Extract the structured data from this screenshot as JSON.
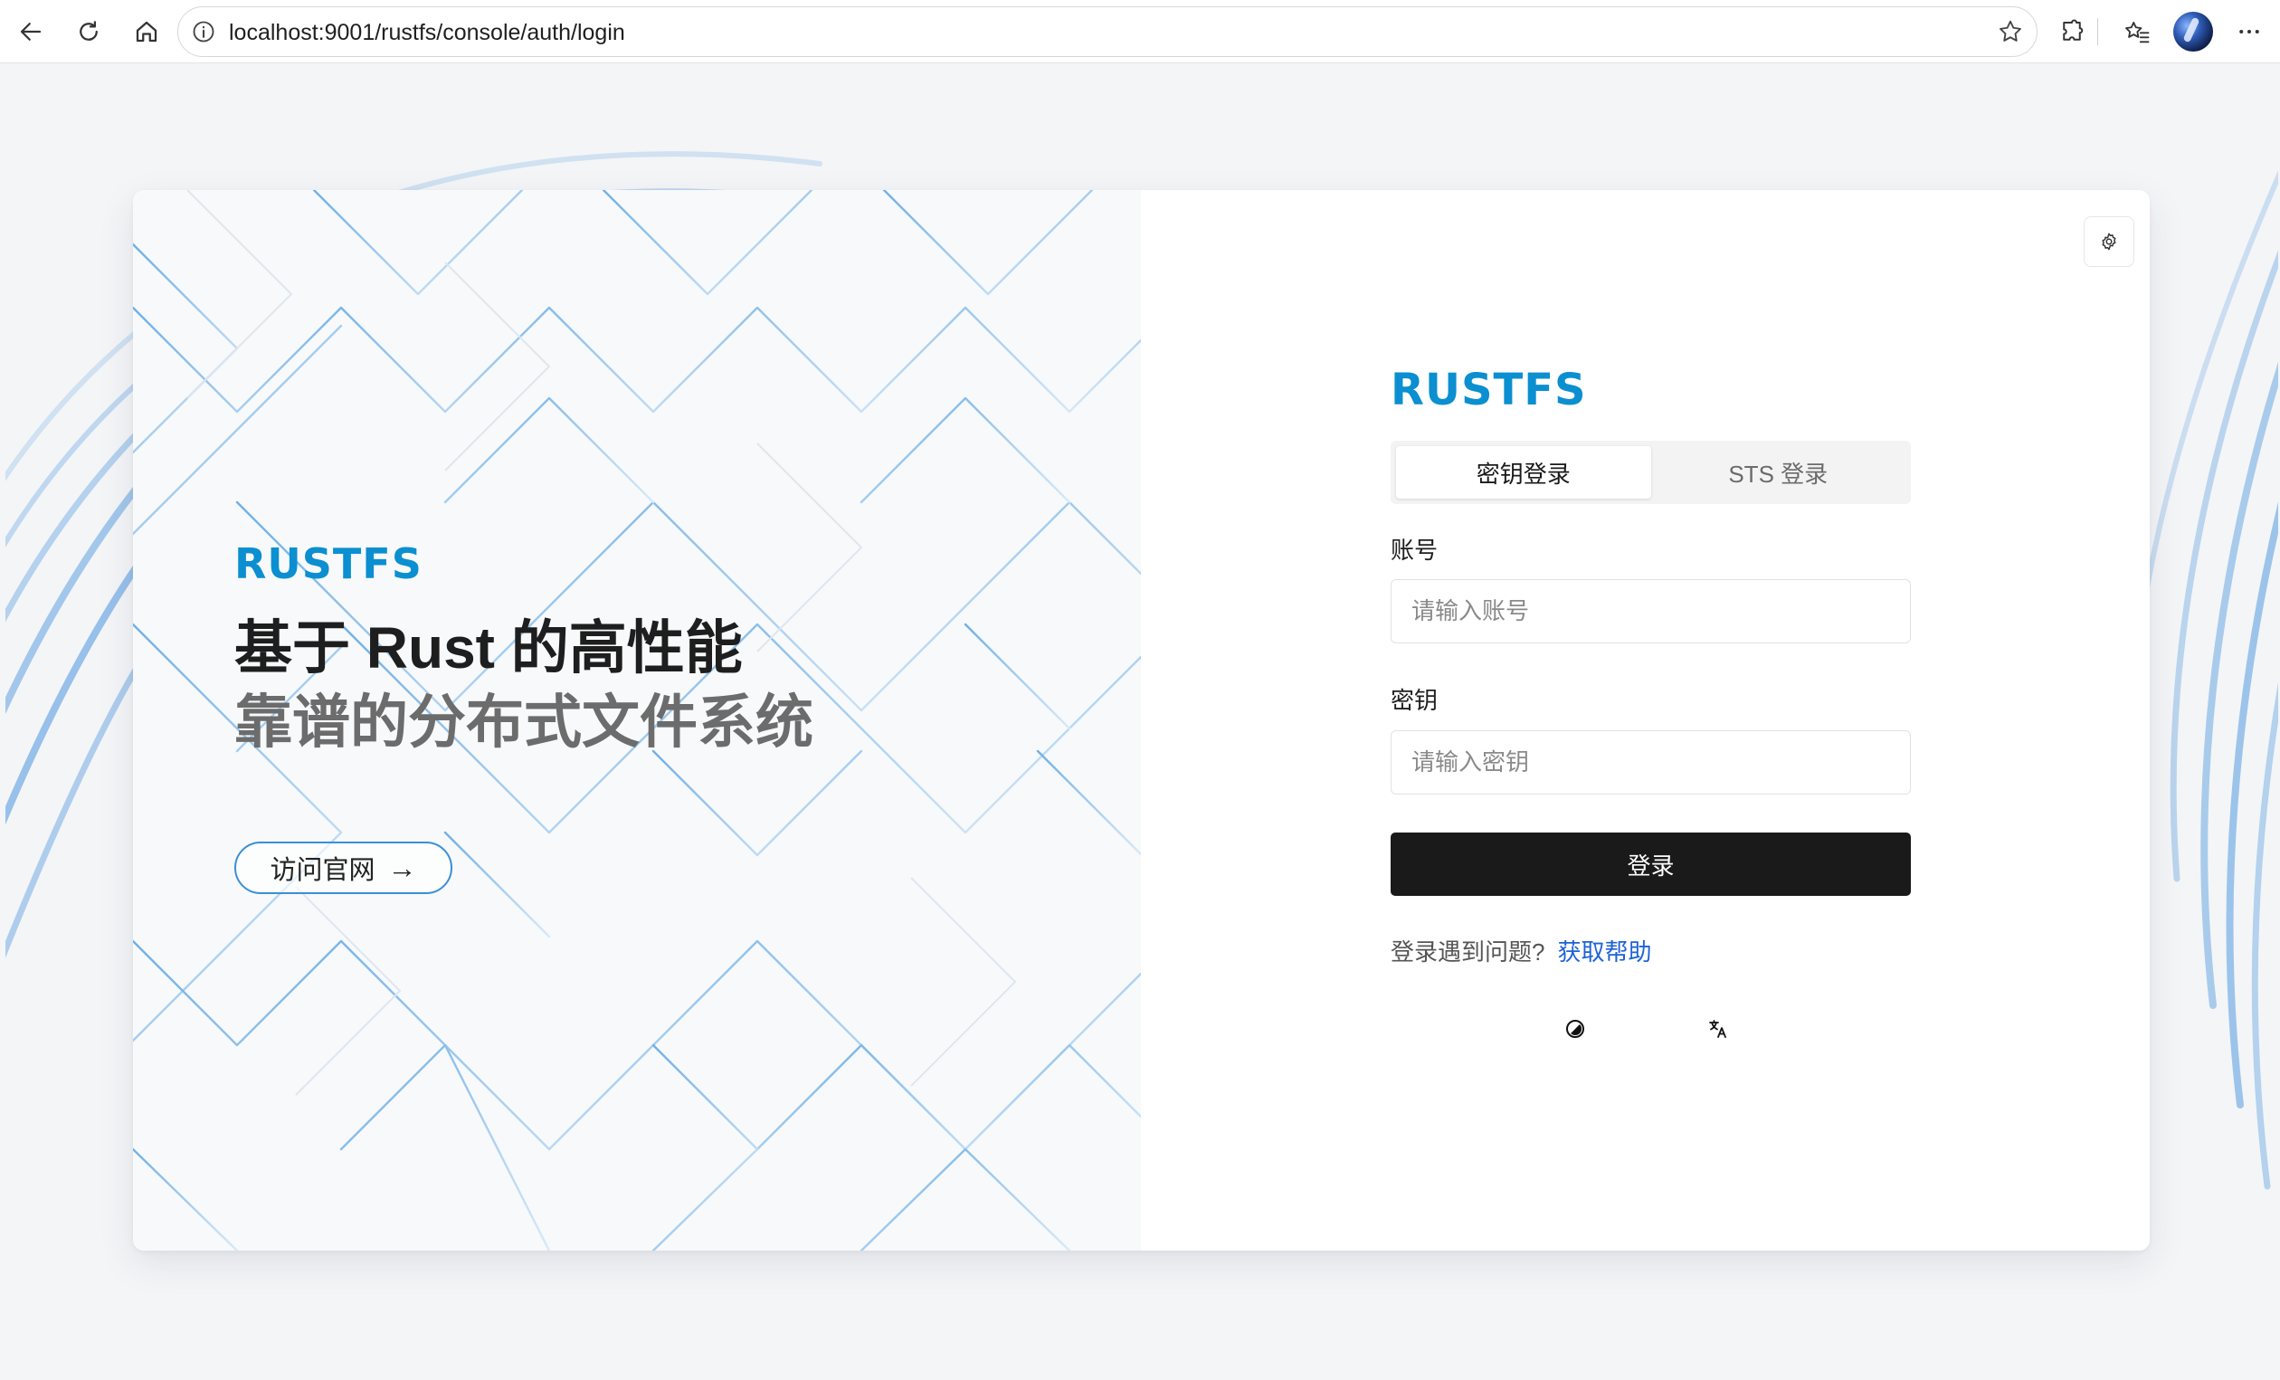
{
  "browser": {
    "url": "localhost:9001/rustfs/console/auth/login"
  },
  "brand": {
    "logo_text": "RUSTFS",
    "color": "#0b8fd0"
  },
  "hero": {
    "headline_line1": "基于 Rust 的高性能",
    "headline_line2": "靠谱的分布式文件系统",
    "visit_button_label": "访问官网",
    "visit_button_arrow": "→"
  },
  "login": {
    "tabs": [
      {
        "label": "密钥登录",
        "active": true
      },
      {
        "label": "STS 登录",
        "active": false
      }
    ],
    "account_label": "账号",
    "account_placeholder": "请输入账号",
    "secret_label": "密钥",
    "secret_placeholder": "请输入密钥",
    "submit_label": "登录",
    "help_text": "登录遇到问题?",
    "help_link": "获取帮助"
  },
  "icons": {
    "settings": "gear-icon",
    "theme": "theme-toggle-icon",
    "language": "translate-icon"
  },
  "colors": {
    "primary_button": "#1a1a1a",
    "link": "#1d62d6",
    "accent_line": "#3a8fd6"
  }
}
